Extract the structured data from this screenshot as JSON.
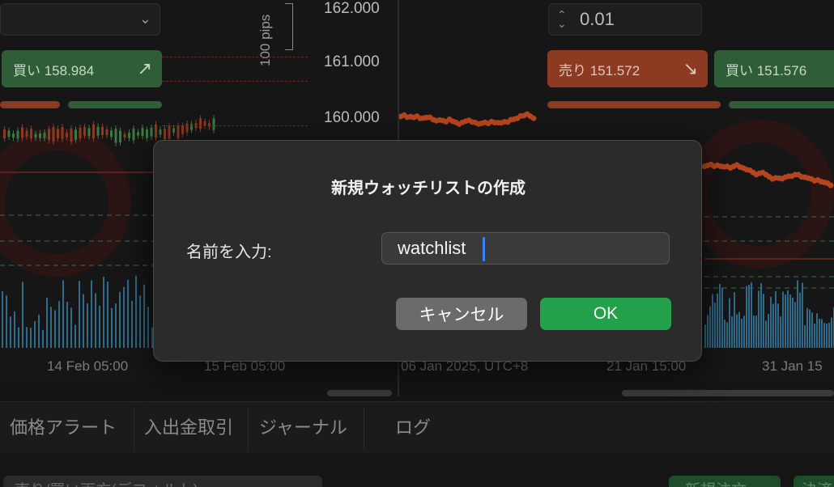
{
  "left_chart": {
    "buy_button": "買い 158.984",
    "price_levels": [
      "162.000",
      "161.000",
      "160.000"
    ],
    "pips_label": "100 pips",
    "time_labels": [
      "14 Feb 05:00",
      "15 Feb 05:00"
    ]
  },
  "right_chart": {
    "lot_size": "0.01",
    "sell_button": "売り 151.572",
    "buy_button": "買い 151.576",
    "time_labels": [
      "06 Jan 2025, UTC+8",
      "21 Jan 15:00",
      "31 Jan 15"
    ]
  },
  "tabs": [
    "価格アラート",
    "入出金取引",
    "ジャーナル",
    "ログ"
  ],
  "bottom": {
    "dropdown": "売り/買い両方(デフォルト)",
    "new_order": "新規注文",
    "settle": "決済"
  },
  "dialog": {
    "title": "新規ウォッチリストの作成",
    "name_label": "名前を入力:",
    "name_value": "watchlist",
    "cancel_label": "キャンセル",
    "ok_label": "OK"
  },
  "colors": {
    "buy": "#2f5e36",
    "sell": "#8c3a22",
    "ok_button": "#22a14a",
    "cancel_button": "#6b6b6b",
    "caret": "#3b82f6"
  }
}
